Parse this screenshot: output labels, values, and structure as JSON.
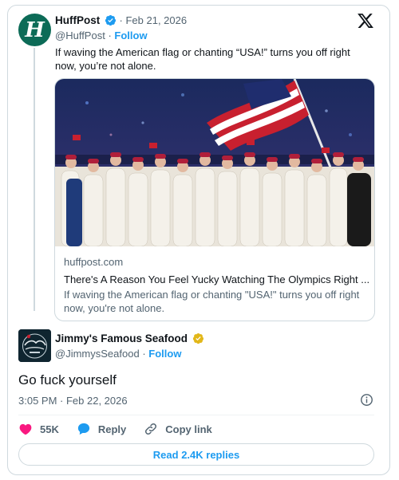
{
  "parent": {
    "avatar_letter": "H",
    "name": "HuffPost",
    "date": "Feb 21, 2026",
    "handle": "@HuffPost",
    "separator": "·",
    "follow": "Follow",
    "text": "If waving the American flag or chanting “USA!” turns you off right now, you’re not alone.",
    "link_card": {
      "domain": "huffpost.com",
      "title": "There's A Reason You Feel Yucky Watching The Olympics Right ...",
      "description": "If waving the American flag or chanting \"USA!\" turns you off right now, you're not alone."
    }
  },
  "main": {
    "name": "Jimmy's Famous Seafood",
    "handle": "@JimmysSeafood",
    "separator": "·",
    "follow": "Follow",
    "text": "Go fuck yourself",
    "timestamp": "3:05 PM · Feb 22, 2026"
  },
  "actions": {
    "likes": "55K",
    "reply": "Reply",
    "copy_link": "Copy link"
  },
  "read_replies": "Read 2.4K replies",
  "colors": {
    "accent": "#1d9bf0",
    "verified_blue": "#1d9bf0",
    "verified_gold": "#e2b719",
    "like_red": "#f91880",
    "huffpost_green": "#0c6b57",
    "muted_text": "#536471",
    "border": "#cfd9de"
  },
  "icons": {
    "verified": "verified-badge-icon",
    "x_logo": "x-logo-icon",
    "heart": "heart-icon",
    "reply": "speech-bubble-icon",
    "copy_link": "link-icon",
    "info": "info-icon"
  }
}
